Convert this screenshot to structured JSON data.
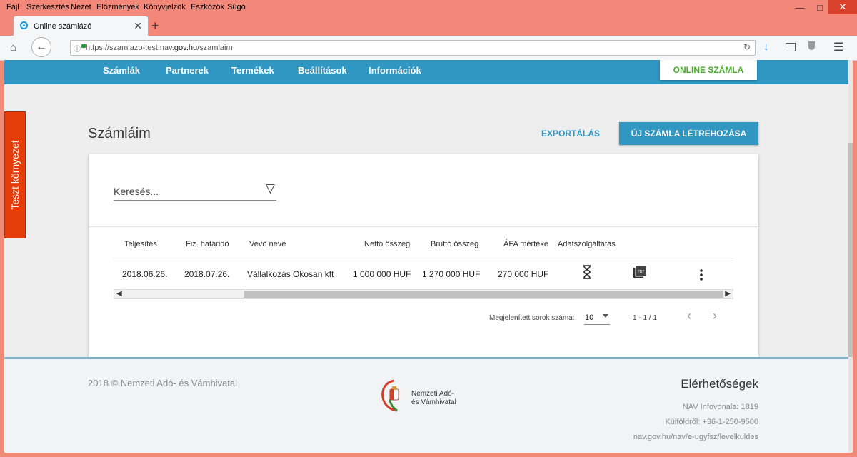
{
  "browser": {
    "menu": [
      "Fájl",
      "Szerkesztés",
      "Nézet",
      "Előzmények",
      "Könyvjelzők",
      "Eszközök",
      "Súgó"
    ],
    "tab_title": "Online számlázó",
    "new_tab": "+",
    "url_prefix": "https://szamlazo-test.nav.",
    "url_domain": "gov.hu",
    "url_suffix": "/szamlaim"
  },
  "side_tab": {
    "label": "Teszt környezet"
  },
  "nav": {
    "items": [
      "Számlák",
      "Partnerek",
      "Termékek",
      "Beállítások",
      "Információk"
    ],
    "online_button": "ONLINE SZÁMLA"
  },
  "main": {
    "title": "Számláim",
    "export_label": "EXPORTÁLÁS",
    "new_invoice_label": "ÚJ SZÁMLA LÉTREHOZÁSA",
    "search_placeholder": "Keresés..."
  },
  "table": {
    "headers": [
      "Teljesítés",
      "Fiz. határidő",
      "Vevő neve",
      "Nettó összeg",
      "Bruttó összeg",
      "ÁFA mértéke",
      "Adatszolgáltatás"
    ],
    "rows": [
      {
        "teljesites": "2018.06.26.",
        "hatarido": "2018.07.26.",
        "vevo": "Vállalkozás Okosan kft",
        "netto": "1 000 000 HUF",
        "brutto": "1 270 000 HUF",
        "afa": "270 000 HUF",
        "status_icon": "hourglass-icon",
        "pdf_icon": "pdf-icon",
        "menu_icon": "more-vert-icon"
      }
    ]
  },
  "pager": {
    "rows_label": "Megjelenített sorok száma:",
    "rows_value": "10",
    "range": "1 - 1 / 1"
  },
  "footer": {
    "copyright": "2018 © Nemzeti Adó- és Vámhivatal",
    "logo_line1": "Nemzeti Adó-",
    "logo_line2": "és Vámhivatal",
    "contact_title": "Elérhetőségek",
    "contact_lines": [
      "NAV Infovonala: 1819",
      "Külföldről: +36-1-250-9500",
      "nav.gov.hu/nav/e-ugyfsz/levelkuldes"
    ]
  },
  "colors": {
    "primary": "#2f97c2",
    "online_green": "#4caa2f",
    "test_tab": "#e53d0a"
  }
}
